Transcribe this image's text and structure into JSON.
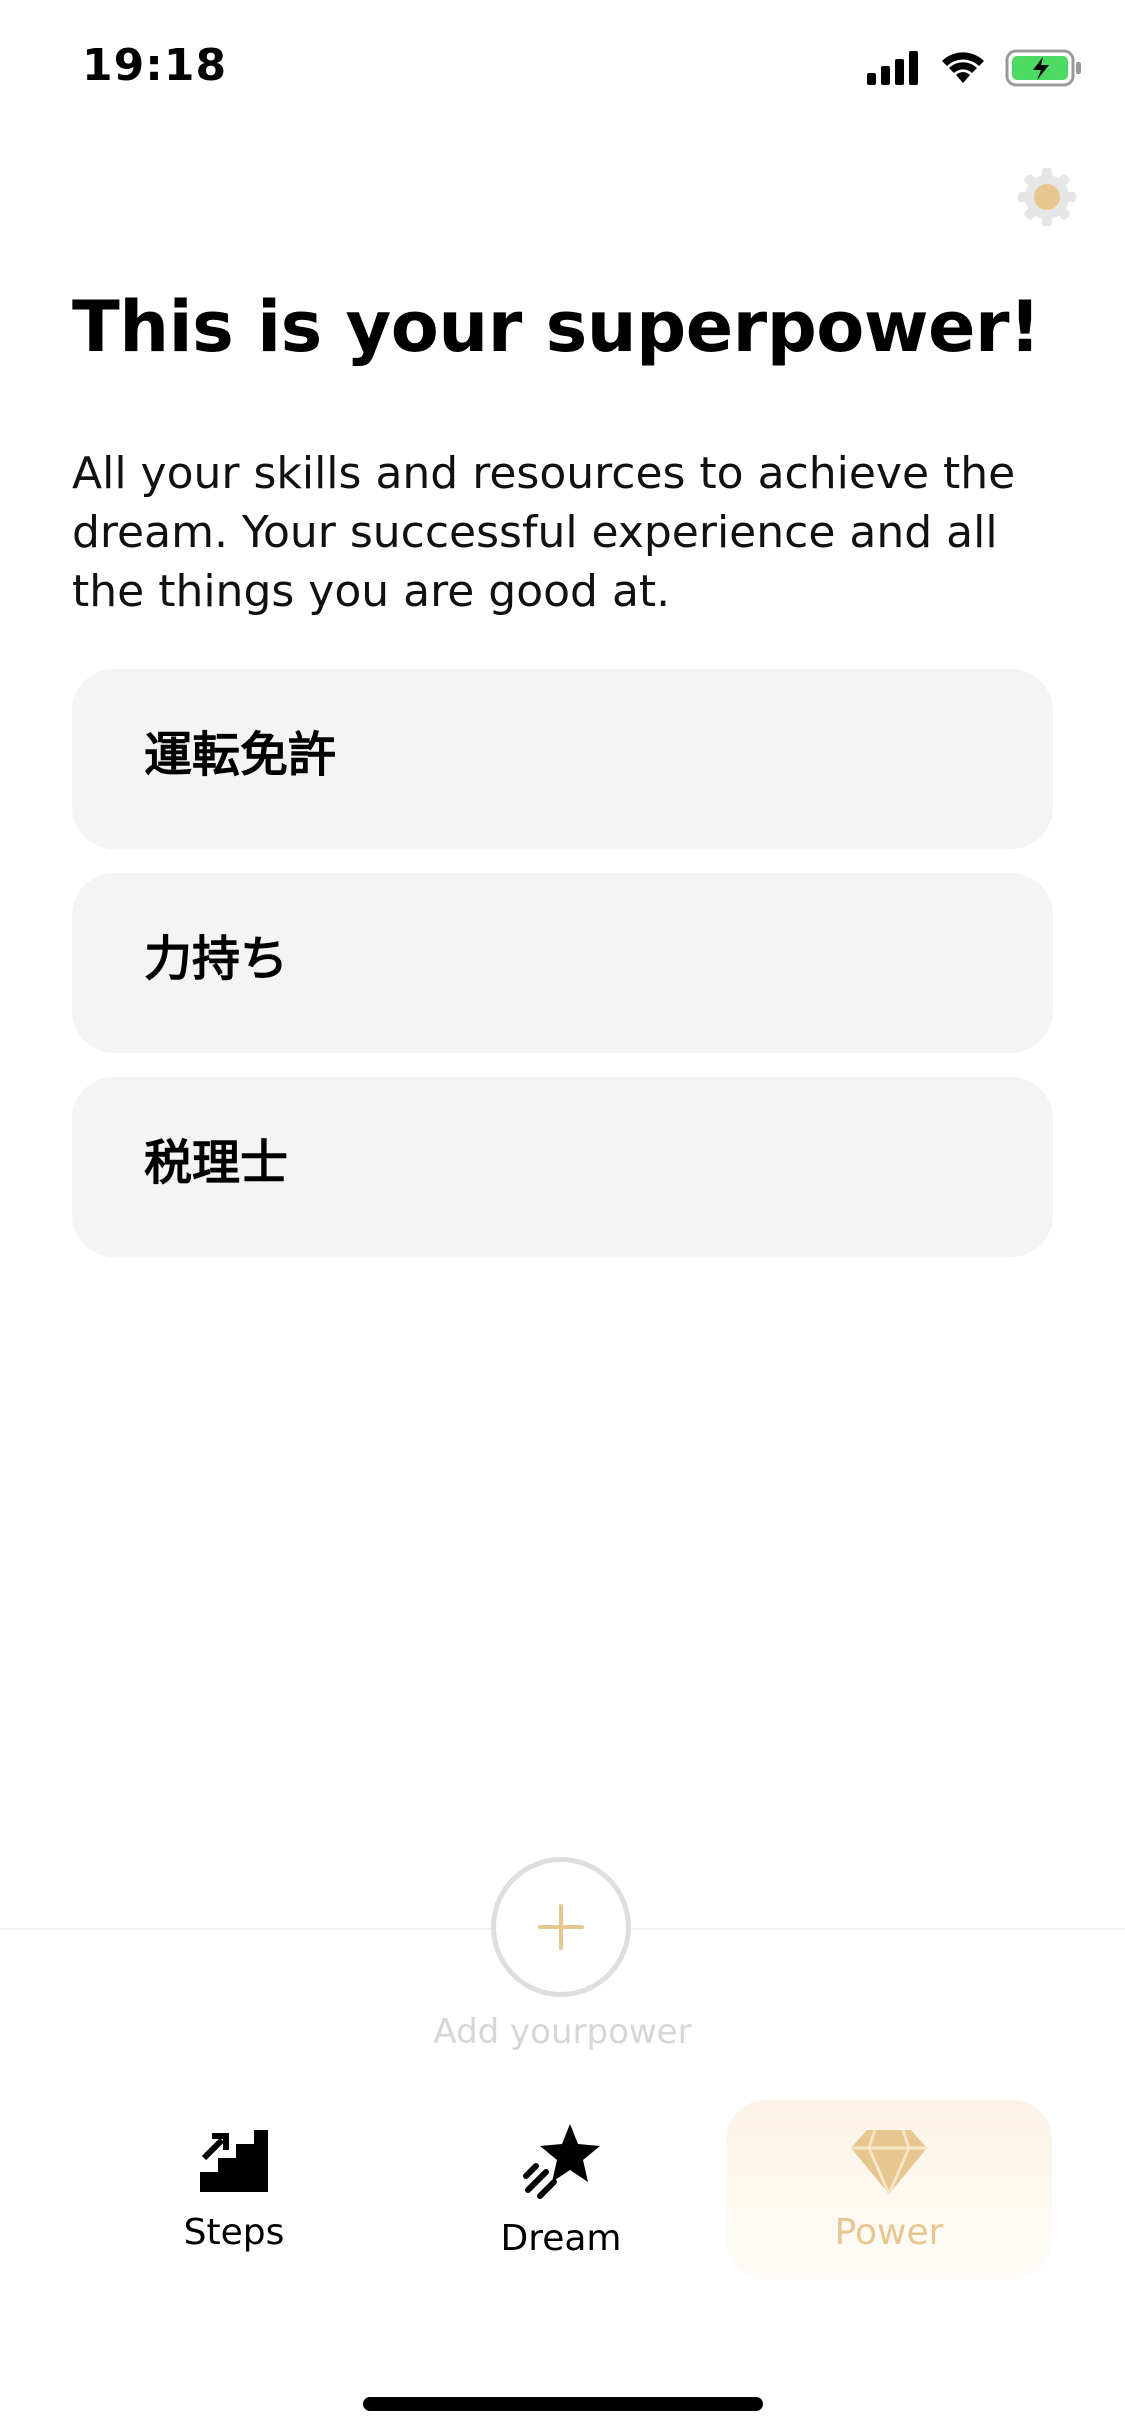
{
  "status_bar": {
    "time": "19:18",
    "icons": [
      "signal-icon",
      "wifi-icon",
      "battery-charging-icon"
    ]
  },
  "header": {
    "settings_icon": "gear-icon",
    "title": "This is your superpower!",
    "description": "All your skills and resources to achieve the dream. Your successful experience and all the things you are good at."
  },
  "powers": [
    {
      "label": "運転免許"
    },
    {
      "label": "力持ち"
    },
    {
      "label": "税理士"
    }
  ],
  "add_power": {
    "icon": "plus-icon",
    "label": "Add yourpower"
  },
  "tabs": [
    {
      "label": "Steps",
      "icon": "stairs-icon",
      "active": false
    },
    {
      "label": "Dream",
      "icon": "shooting-star-icon",
      "active": false
    },
    {
      "label": "Power",
      "icon": "diamond-icon",
      "active": true
    }
  ],
  "colors": {
    "accent": "#e7c68f",
    "card_bg": "#f4f4f4",
    "battery_green": "#4cd964"
  }
}
